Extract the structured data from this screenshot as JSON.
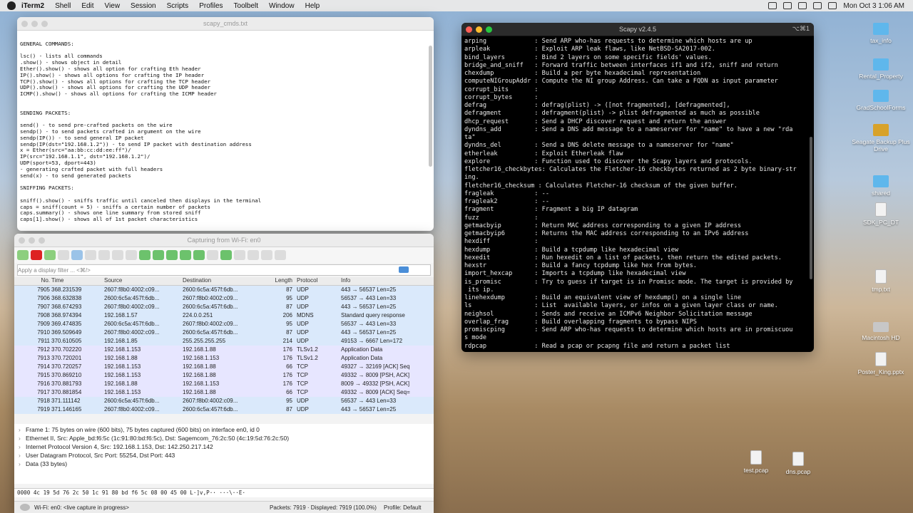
{
  "menubar": {
    "app": "iTerm2",
    "items": [
      "Shell",
      "Edit",
      "View",
      "Session",
      "Scripts",
      "Profiles",
      "Toolbelt",
      "Window",
      "Help"
    ],
    "clock": "Mon Oct 3  1:06 AM"
  },
  "editor": {
    "title": "scapy_cmds.txt",
    "text": "\nGENERAL COMMANDS:\n\nlsc() - lists all commands\n.show() - shows object in detail\nEther().show() - shows all option for crafting Eth header\nIP().show() - shows all options for crafting the IP header\nTCP().show() - shows all options for crafting the TCP header\nUDP().show() - shows all options for crafting the UDP header\nICMP().show() - shows all options for crafting the ICMP header\n\n\nSENDING PACKETS:\n\nsend() - to send pre-crafted packets on the wire\nsendp() - to send packets crafted in argument on the wire\nsendp(IP()) - to send general IP packet\nsendp(IP(dst=\"192.168.1.2\")) - to send IP packet with destination address\nx = Ether(src=\"aa:bb:cc:dd:ee:ff\")/\nIP(src=\"192.168.1.1\", dst=\"192.168.1.2\")/\nUDP(sport=53, dport=443)\n- generating crafted packet with full headers\nsend(x) - to send generated packets\n\nSNIFFING PACKETS:\n\nsniff().show() - sniffs traffic until canceled then displays in the terminal\ncaps = sniff(count = 5) - sniffs a certain number of packets\ncaps.summary() - shows one line summary from stored sniff\ncaps[1].show() - shows all of 1st packet characteristics"
  },
  "wireshark": {
    "title": "Capturing from Wi-Fi: en0",
    "filter_placeholder": "Apply a display filter ... <⌘/>",
    "columns": [
      "No.",
      "Time",
      "Source",
      "Destination",
      "Length",
      "Protocol",
      "Info"
    ],
    "rows": [
      {
        "no": "7905",
        "time": "368.231539",
        "src": "2607:f8b0:4002:c09...",
        "dst": "2600:6c5a:457f:6db...",
        "len": "87",
        "proto": "UDP",
        "info": "443 → 56537 Len=25",
        "kind": "udp"
      },
      {
        "no": "7906",
        "time": "368.632838",
        "src": "2600:6c5a:457f:6db...",
        "dst": "2607:f8b0:4002:c09...",
        "len": "95",
        "proto": "UDP",
        "info": "56537 → 443 Len=33",
        "kind": "udp"
      },
      {
        "no": "7907",
        "time": "368.674293",
        "src": "2607:f8b0:4002:c09...",
        "dst": "2600:6c5a:457f:6db...",
        "len": "87",
        "proto": "UDP",
        "info": "443 → 56537 Len=25",
        "kind": "udp"
      },
      {
        "no": "7908",
        "time": "368.974394",
        "src": "192.168.1.57",
        "dst": "224.0.0.251",
        "len": "206",
        "proto": "MDNS",
        "info": "Standard query response",
        "kind": "mdns"
      },
      {
        "no": "7909",
        "time": "369.474835",
        "src": "2600:6c5a:457f:6db...",
        "dst": "2607:f8b0:4002:c09...",
        "len": "95",
        "proto": "UDP",
        "info": "56537 → 443 Len=33",
        "kind": "udp"
      },
      {
        "no": "7910",
        "time": "369.509649",
        "src": "2607:f8b0:4002:c09...",
        "dst": "2600:6c5a:457f:6db...",
        "len": "87",
        "proto": "UDP",
        "info": "443 → 56537 Len=25",
        "kind": "udp"
      },
      {
        "no": "7911",
        "time": "370.610505",
        "src": "192.168.1.85",
        "dst": "255.255.255.255",
        "len": "214",
        "proto": "UDP",
        "info": "49153 → 6667 Len=172",
        "kind": "udp"
      },
      {
        "no": "7912",
        "time": "370.702220",
        "src": "192.168.1.153",
        "dst": "192.168.1.88",
        "len": "176",
        "proto": "TLSv1.2",
        "info": "Application Data",
        "kind": "tls"
      },
      {
        "no": "7913",
        "time": "370.720201",
        "src": "192.168.1.88",
        "dst": "192.168.1.153",
        "len": "176",
        "proto": "TLSv1.2",
        "info": "Application Data",
        "kind": "tls"
      },
      {
        "no": "7914",
        "time": "370.720257",
        "src": "192.168.1.153",
        "dst": "192.168.1.88",
        "len": "66",
        "proto": "TCP",
        "info": "49327 → 32169 [ACK] Seq",
        "kind": "tcp"
      },
      {
        "no": "7915",
        "time": "370.869210",
        "src": "192.168.1.153",
        "dst": "192.168.1.88",
        "len": "176",
        "proto": "TCP",
        "info": "49332 → 8009 [PSH, ACK]",
        "kind": "tcp"
      },
      {
        "no": "7916",
        "time": "370.881793",
        "src": "192.168.1.88",
        "dst": "192.168.1.153",
        "len": "176",
        "proto": "TCP",
        "info": "8009 → 49332 [PSH, ACK]",
        "kind": "tcp"
      },
      {
        "no": "7917",
        "time": "370.881854",
        "src": "192.168.1.153",
        "dst": "192.168.1.88",
        "len": "66",
        "proto": "TCP",
        "info": "49332 → 8009 [ACK] Seq=",
        "kind": "tcp"
      },
      {
        "no": "7918",
        "time": "371.111142",
        "src": "2600:6c5a:457f:6db...",
        "dst": "2607:f8b0:4002:c09...",
        "len": "95",
        "proto": "UDP",
        "info": "56537 → 443 Len=33",
        "kind": "udp"
      },
      {
        "no": "7919",
        "time": "371.146165",
        "src": "2607:f8b0:4002:c09...",
        "dst": "2600:6c5a:457f:6db...",
        "len": "87",
        "proto": "UDP",
        "info": "443 → 56537 Len=25",
        "kind": "udp"
      }
    ],
    "details": [
      "Frame 1: 75 bytes on wire (600 bits), 75 bytes captured (600 bits) on interface en0, id 0",
      "Ethernet II, Src: Apple_bd:f6:5c (1c:91:80:bd:f6:5c), Dst: Sagemcom_76:2c:50 (4c:19:5d:76:2c:50)",
      "Internet Protocol Version 4, Src: 192.168.1.153, Dst: 142.250.217.142",
      "User Datagram Protocol, Src Port: 55254, Dst Port: 443",
      "Data (33 bytes)"
    ],
    "hex_line": "0000  4c 19 5d 76 2c 50 1c 91  80 bd f6 5c 08 00 45 00   L·]v,P·· ···\\··E·",
    "status_left": "Wi-Fi: en0: <live capture in progress>",
    "status_packets": "Packets: 7919 · Displayed: 7919 (100.0%)",
    "status_profile": "Profile: Default"
  },
  "terminal": {
    "title": "Scapy v2.4.5",
    "shortcut": "⌥⌘1",
    "text": "arping             : Send ARP who-has requests to determine which hosts are up\narpleak            : Exploit ARP leak flaws, like NetBSD-SA2017-002.\nbind_layers        : Bind 2 layers on some specific fields' values.\nbridge_and_sniff   : Forward traffic between interfaces if1 and if2, sniff and return\nchexdump           : Build a per byte hexadecimal representation\ncomputeNIGroupAddr : Compute the NI group Address. Can take a FQDN as input parameter\ncorrupt_bits       :\ncorrupt_bytes      :\ndefrag             : defrag(plist) -> ([not fragmented], [defragmented],\ndefragment         : defragment(plist) -> plist defragmented as much as possible\ndhcp_request       : Send a DHCP discover request and return the answer\ndyndns_add         : Send a DNS add message to a nameserver for \"name\" to have a new \"rda\nta\"\ndyndns_del         : Send a DNS delete message to a nameserver for \"name\"\netherleak          : Exploit Etherleak flaw\nexplore            : Function used to discover the Scapy layers and protocols.\nfletcher16_checkbytes: Calculates the Fletcher-16 checkbytes returned as 2 byte binary-str\ning.\nfletcher16_checksum : Calculates Fletcher-16 checksum of the given buffer.\nfragleak           : --\nfragleak2          : --\nfragment           : Fragment a big IP datagram\nfuzz               :\ngetmacbyip         : Return MAC address corresponding to a given IP address\ngetmacbyip6        : Returns the MAC address corresponding to an IPv6 address\nhexdiff            :\nhexdump            : Build a tcpdump like hexadecimal view\nhexedit            : Run hexedit on a list of packets, then return the edited packets.\nhexstr             : Build a fancy tcpdump like hex from bytes.\nimport_hexcap      : Imports a tcpdump like hexadecimal view\nis_promisc         : Try to guess if target is in Promisc mode. The target is provided by\n its ip.\nlinehexdump        : Build an equivalent view of hexdump() on a single line\nls                 : List  available layers, or infos on a given layer class or name.\nneighsol           : Sends and receive an ICMPv6 Neighbor Solicitation message\noverlap_frag       : Build overlapping fragments to bypass NIPS\npromiscping        : Send ARP who-has requests to determine which hosts are in promiscuou\ns mode\nrdpcap             : Read a pcap or pcapng file and return a packet list"
  },
  "desktop": {
    "icons": [
      {
        "label": "tax_info",
        "type": "folder"
      },
      {
        "label": "Rental_Property",
        "type": "folder"
      },
      {
        "label": "GradSchoolForms",
        "type": "folder"
      },
      {
        "label": "Seagate Backup Plus Drive",
        "type": "drive"
      },
      {
        "label": "shared",
        "type": "folder"
      },
      {
        "label": "SDK_PC_DT",
        "type": "doc"
      },
      {
        "label": "tmp.txt",
        "type": "doc"
      },
      {
        "label": "Macintosh HD",
        "type": "hd"
      },
      {
        "label": "Poster_King.pptx",
        "type": "doc"
      },
      {
        "label": "test.pcap",
        "type": "doc"
      },
      {
        "label": "dns.pcap",
        "type": "doc"
      }
    ]
  }
}
